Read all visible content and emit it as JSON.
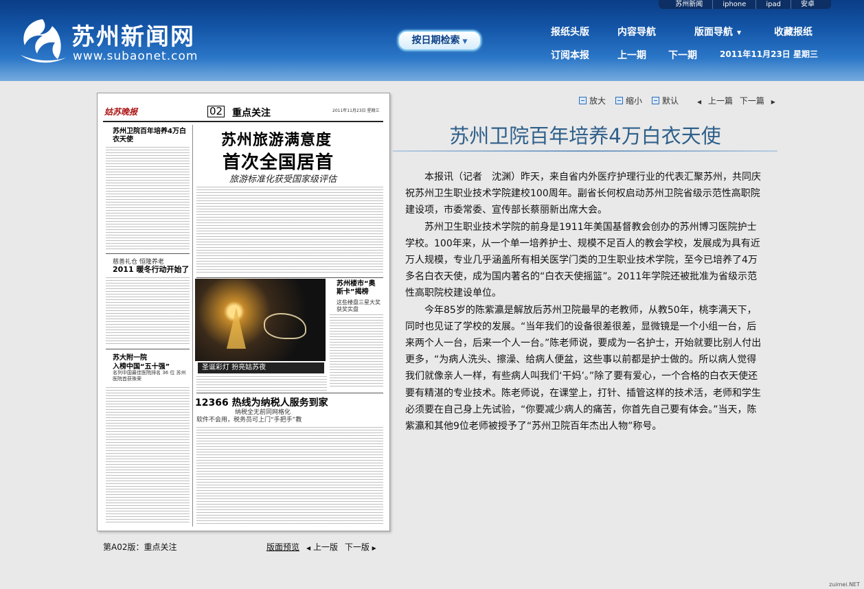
{
  "header": {
    "top_nav": [
      "苏州新闻",
      "iphone",
      "ipad",
      "安卓"
    ],
    "logo_cn": "苏州新闻网",
    "logo_en": "www.subaonet.com",
    "date_search_label": "按日期检索",
    "nav_row1": [
      "报纸头版",
      "内容导航",
      "版面导航",
      "收藏报纸"
    ],
    "nav_row2": [
      "订阅本报",
      "上一期",
      "下一期"
    ],
    "date_text": "2011年11月23日  星期三"
  },
  "paper_preview": {
    "masthead": "姑苏晚报",
    "page_no": "02",
    "section": "重点关注",
    "date_small": "2011年11月23日 星期三",
    "left_col1_headline": "苏州卫院百年培养4万白衣天使",
    "main_headline1": "苏州旅游满意度",
    "main_headline2": "首次全国居首",
    "main_subhead": "旅游标准化获受国家级评估",
    "left_col2_headline": "2011 暖冬行动开始了",
    "left_col2_kicker": "慈善礼仓 恒隆养老",
    "right_headline": "苏州楼市“奥斯卡”揭榜",
    "right_subhead": "这些楼盘三星大奖 获奖实盘",
    "photo_caption": "圣诞彩灯 扮亮姑苏夜",
    "left_col3_headline1": "苏大附一院",
    "left_col3_headline2": "入榜中国“五十强”",
    "left_col3_sub": "名列中国最佳医院排名 36 位 苏州医院首获殊荣",
    "bottom_headline": "12366 热线为纳税人服务到家",
    "bottom_sub1": "纳税全无前同网格化",
    "bottom_sub2": "软件不会用，税务员可上门“手把手”教"
  },
  "tools": {
    "zoom_in": "放大",
    "zoom_out": "缩小",
    "default": "默认",
    "prev": "上一篇",
    "next": "下一篇"
  },
  "article": {
    "title": "苏州卫院百年培养4万白衣天使",
    "paragraphs": [
      "本报讯（记者　沈渊）昨天，来自省内外医疗护理行业的代表汇聚苏州，共同庆祝苏州卫生职业技术学院建校100周年。副省长何权启动苏州卫院省级示范性高职院建设项，市委常委、宣传部长蔡丽新出席大会。",
      "苏州卫生职业技术学院的前身是1911年美国基督教会创办的苏州博习医院护士学校。100年来，从一个单一培养护士、规模不足百人的教会学校，发展成为具有近万人规模，专业几乎涵盖所有相关医学门类的卫生职业技术学院，至今已培养了4万多名白衣天使，成为国内著名的“白衣天使摇篮”。2011年学院还被批准为省级示范性高职院校建设单位。",
      "今年85岁的陈紫瀛是解放后苏州卫院最早的老教师，从教50年，桃李满天下，同时也见证了学校的发展。“当年我们的设备很差很差，显微镜是一个小组一台，后来两个人一台，后来一个人一台。”陈老师说，要成为一名护士，开始就要比别人付出更多，“为病人洗头、擦澡、给病人便盆，这些事以前都是护士做的。所以病人觉得我们就像亲人一样，有些病人叫我们‘干妈’。”除了要有爱心，一个合格的白衣天使还要有精湛的专业技术。陈老师说，在课堂上，打针、插管这样的技术活，老师和学生必须要在自己身上先试验，“你要减少病人的痛苦，你首先自己要有体会。”当天，陈紫瀛和其他9位老师被授予了“苏州卫院百年杰出人物”称号。"
    ]
  },
  "bottom": {
    "edition": "第A02版：重点关注",
    "preview": "版面预览",
    "prev": "上一版",
    "next": "下一版"
  },
  "watermark": "zuimei.NET"
}
